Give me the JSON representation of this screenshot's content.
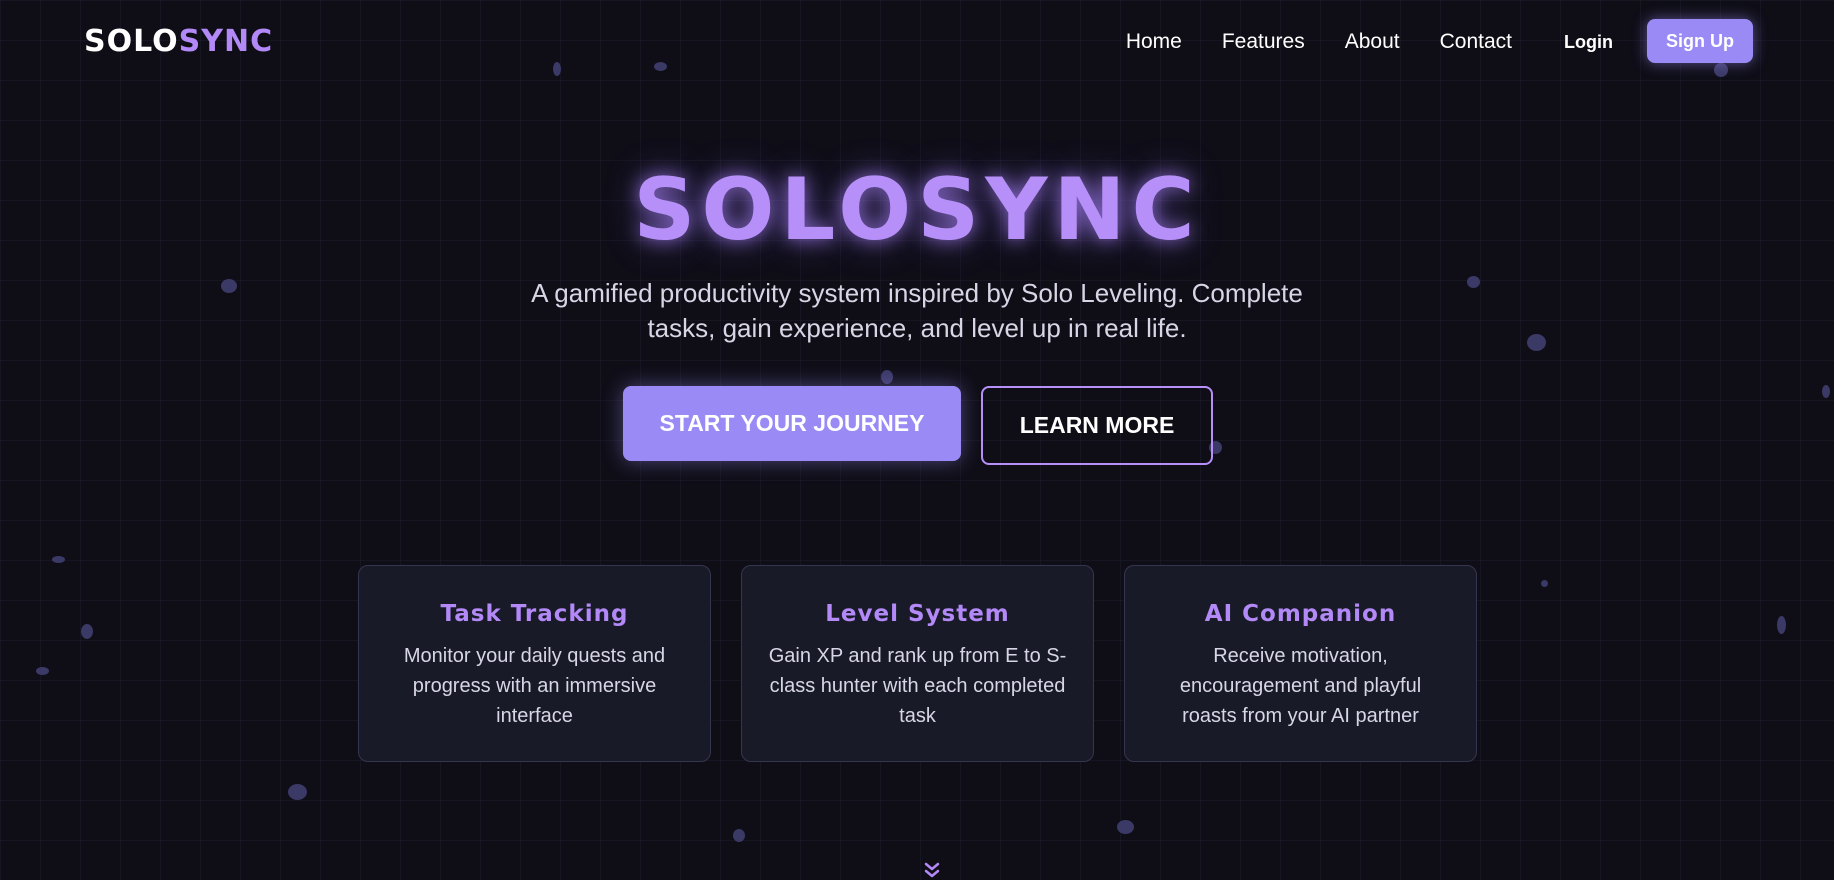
{
  "nav": {
    "logo_part1": "SOLO",
    "logo_part2": "SYNC",
    "links": [
      "Home",
      "Features",
      "About",
      "Contact"
    ],
    "login_label": "Login",
    "signup_label": "Sign Up"
  },
  "hero": {
    "title": "SOLOSYNC",
    "subtitle": "A gamified productivity system inspired by Solo Leveling. Complete tasks, gain experience, and level up in real life.",
    "primary_cta": "START YOUR JOURNEY",
    "secondary_cta": "LEARN MORE"
  },
  "features": [
    {
      "title": "Task Tracking",
      "description": "Monitor your daily quests and progress with an immersive interface"
    },
    {
      "title": "Level System",
      "description": "Gain XP and rank up from E to S-class hunter with each completed task"
    },
    {
      "title": "AI Companion",
      "description": "Receive motivation, encouragement and playful roasts from your AI partner"
    }
  ],
  "icons": {
    "scroll_indicator": "double-chevron-down-icon"
  },
  "colors": {
    "background": "#0f0e17",
    "accent": "#9a8af5",
    "accent_text": "#b388f7",
    "card_bg": "#181a27"
  }
}
